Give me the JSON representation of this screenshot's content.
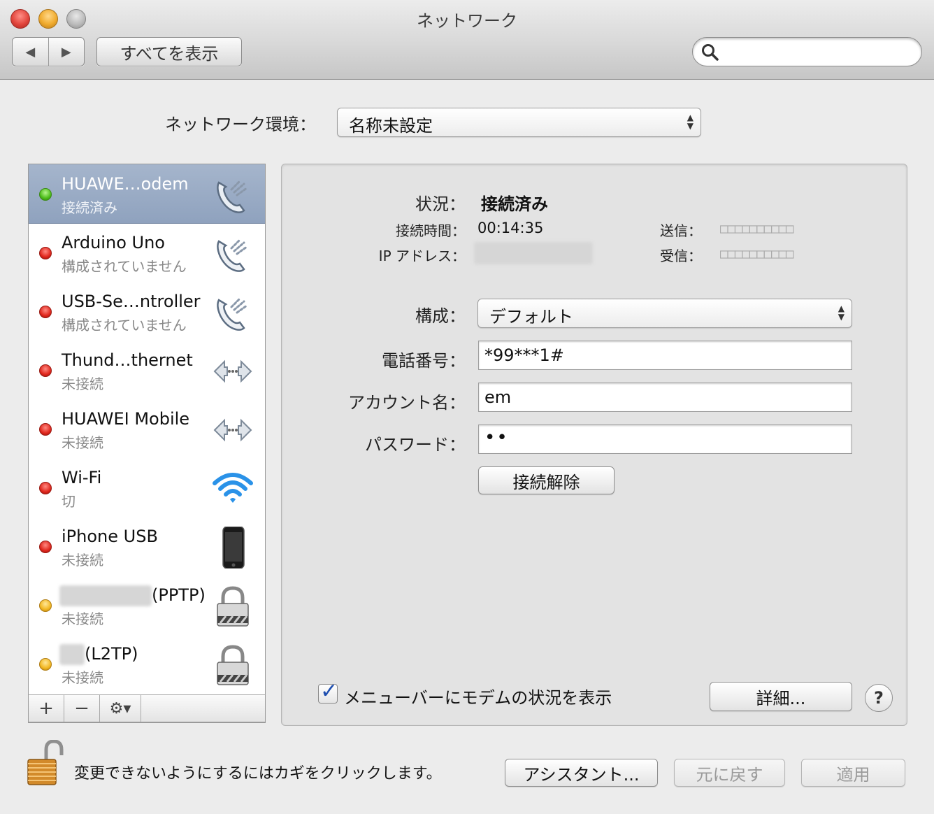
{
  "window": {
    "title": "ネットワーク"
  },
  "toolbar": {
    "back_label": "◀",
    "forward_label": "▶",
    "show_all_label": "すべてを表示",
    "search_value": "",
    "search_placeholder": ""
  },
  "location": {
    "label": "ネットワーク環境：",
    "value": "名称未設定"
  },
  "services": [
    {
      "name": "HUAWE…odem",
      "status": "接続済み",
      "dot": "green",
      "icon": "phone-modem-icon",
      "selected": true
    },
    {
      "name": "Arduino Uno",
      "status": "構成されていません",
      "dot": "red",
      "icon": "phone-modem-icon",
      "selected": false
    },
    {
      "name": "USB-Se…ntroller",
      "status": "構成されていません",
      "dot": "red",
      "icon": "phone-modem-icon",
      "selected": false
    },
    {
      "name": "Thund…thernet",
      "status": "未接続",
      "dot": "red",
      "icon": "ethernet-arrows-icon",
      "selected": false
    },
    {
      "name": "HUAWEI Mobile",
      "status": "未接続",
      "dot": "red",
      "icon": "ethernet-arrows-icon",
      "selected": false
    },
    {
      "name": "Wi-Fi",
      "status": "切",
      "dot": "red",
      "icon": "wifi-icon",
      "selected": false
    },
    {
      "name": "iPhone USB",
      "status": "未接続",
      "dot": "red",
      "icon": "iphone-icon",
      "selected": false
    },
    {
      "name": "(PPTP)",
      "status": "未接続",
      "dot": "yellow",
      "icon": "vpn-lock-icon",
      "selected": false
    },
    {
      "name": "(L2TP)",
      "status": "未接続",
      "dot": "yellow",
      "icon": "vpn-lock-icon",
      "selected": false
    }
  ],
  "list_toolbar": {
    "add_label": "+",
    "remove_label": "−",
    "gear_label": "⚙▾"
  },
  "detail": {
    "status_label": "状況：",
    "status_value": "接続済み",
    "connect_time_label": "接続時間：",
    "connect_time_value": "00:14:35",
    "ip_label": "IP アドレス：",
    "send_label": "送信：",
    "send_meter": "□□□□□□□□□□",
    "receive_label": "受信：",
    "receive_meter": "□□□□□□□□□□",
    "config_label": "構成：",
    "config_value": "デフォルト",
    "phone_label": "電話番号：",
    "phone_value": "*99***1#",
    "account_label": "アカウント名：",
    "account_value": "em",
    "password_label": "パスワード：",
    "password_value": "••",
    "disconnect_label": "接続解除",
    "show_status_label": "メニューバーにモデムの状況を表示",
    "show_status_checked": true,
    "advanced_label": "詳細...",
    "help_label": "?"
  },
  "bottom": {
    "lock_text": "変更できないようにするにはカギをクリックします。",
    "assistant_label": "アシスタント...",
    "revert_label": "元に戻す",
    "apply_label": "適用"
  },
  "colors": {
    "selection": "#97a9c3",
    "status_green": "#4cbc1a",
    "status_red": "#e0261c",
    "status_yellow": "#f2b722",
    "checkbox_mark": "#1f4fb0"
  }
}
